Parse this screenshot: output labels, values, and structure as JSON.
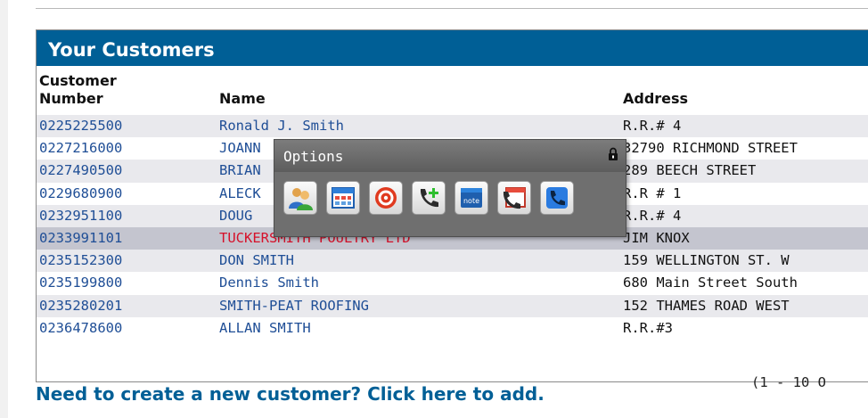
{
  "panel": {
    "title": "Your Customers"
  },
  "columns": {
    "number": "Customer\nNumber",
    "name": "Name",
    "address": "Address"
  },
  "rows": [
    {
      "number": "0225225500",
      "name": "Ronald J. Smith",
      "address": "R.R.# 4"
    },
    {
      "number": "0227216000",
      "name": "JOANN",
      "address": "32790 RICHMOND STREET"
    },
    {
      "number": "0227490500",
      "name": "BRIAN",
      "address": "289 BEECH STREET"
    },
    {
      "number": "0229680900",
      "name": "ALECK",
      "address": "R.R # 1"
    },
    {
      "number": "0232951100",
      "name": "DOUG",
      "address": "R.R.# 4"
    },
    {
      "number": "0233991101",
      "name": "TUCKERSMITH POULTRY LTD",
      "address": "JIM KNOX"
    },
    {
      "number": "0235152300",
      "name": "DON SMITH",
      "address": "159 WELLINGTON ST. W"
    },
    {
      "number": "0235199800",
      "name": "Dennis Smith",
      "address": "680 Main Street South"
    },
    {
      "number": "0235280201",
      "name": "SMITH-PEAT ROOFING",
      "address": "152 THAMES ROAD WEST"
    },
    {
      "number": "0236478600",
      "name": "ALLAN SMITH",
      "address": "R.R.#3"
    }
  ],
  "pager": "(1 - 10 O",
  "add_link": "Need to create a new customer? Click here to add.",
  "popup": {
    "title": "Options",
    "icons": [
      "contacts-icon",
      "calendar-grid-icon",
      "target-icon",
      "call-add-icon",
      "note-icon",
      "calendar-phone-icon",
      "phone-icon"
    ]
  },
  "colors": {
    "header": "#005f96",
    "link": "#1f4e96",
    "selected_name": "#d6112a",
    "selected_row": "#c4c5cf",
    "alt_row": "#e9e9ed"
  }
}
